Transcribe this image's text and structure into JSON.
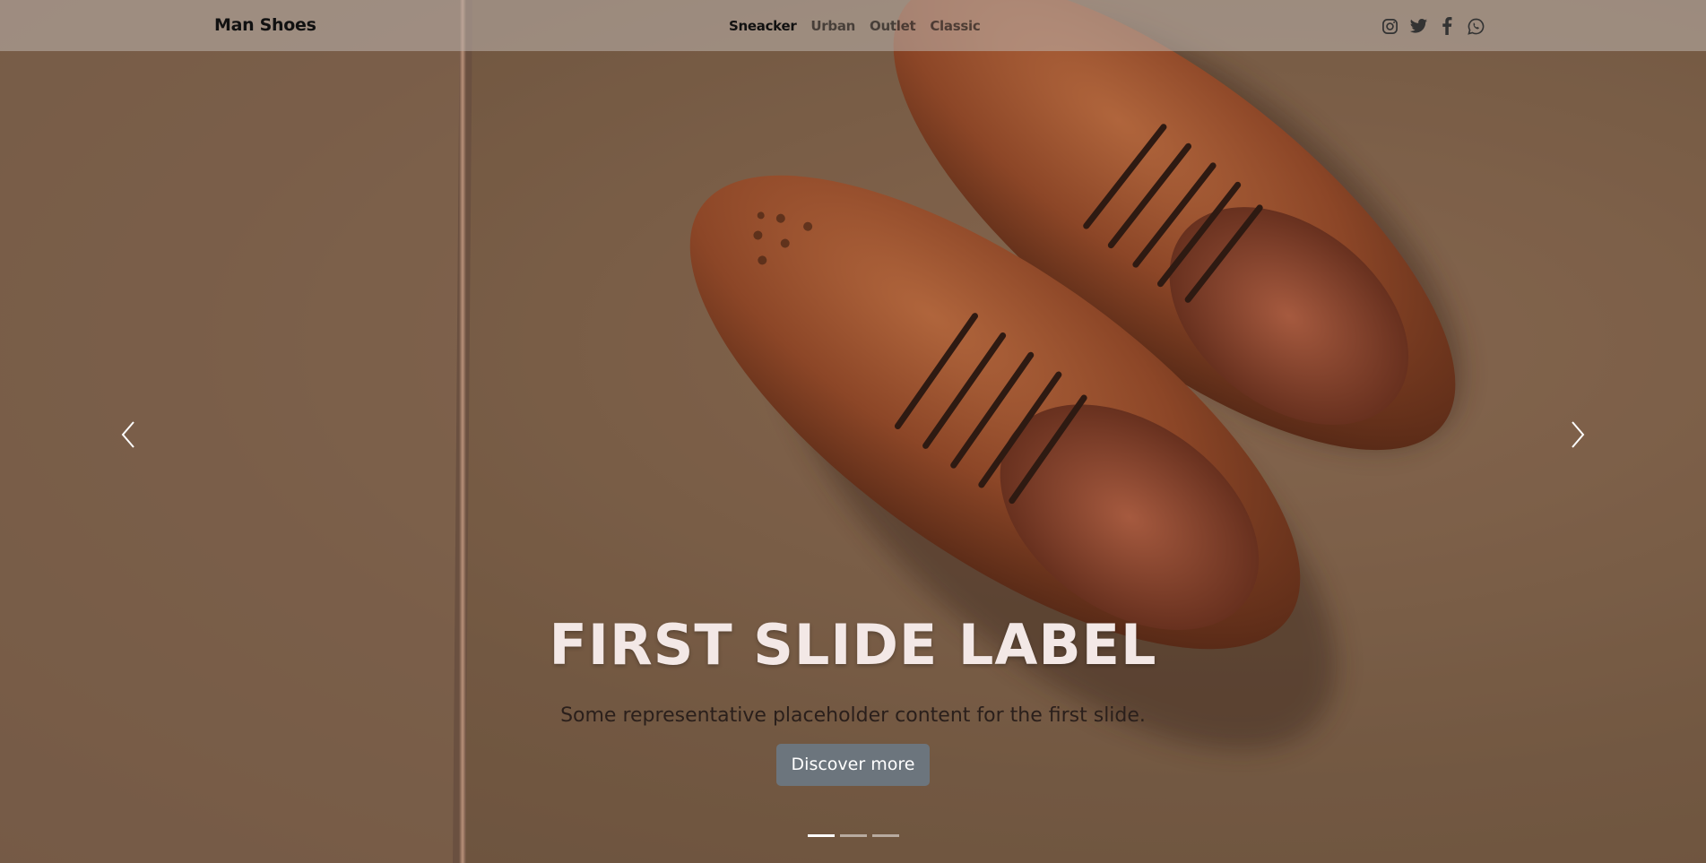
{
  "navbar": {
    "brand": "Man Shoes",
    "links": [
      {
        "label": "Sneacker",
        "active": true
      },
      {
        "label": "Urban",
        "active": false
      },
      {
        "label": "Outlet",
        "active": false
      },
      {
        "label": "Classic",
        "active": false
      }
    ],
    "social_icons": [
      "instagram-icon",
      "twitter-icon",
      "facebook-icon",
      "whatsapp-icon"
    ]
  },
  "carousel": {
    "slide": {
      "title": "FIRST SLIDE LABEL",
      "text": "Some representative placeholder content for the first slide.",
      "button_label": "Discover more"
    },
    "indicator_count": 3,
    "active_indicator": 1
  },
  "colors": {
    "navbar_bg": "#beb4af",
    "button_bg": "#6c757d",
    "title": "#f3e8e6",
    "leather": "#8b4a2b"
  }
}
